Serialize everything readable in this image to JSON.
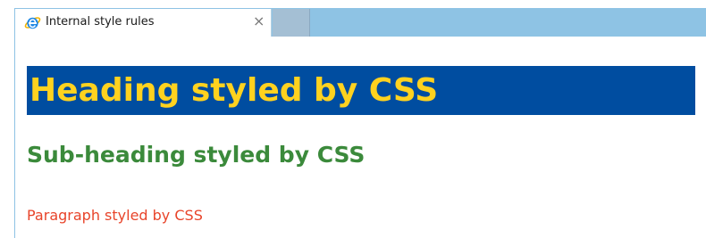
{
  "browser": {
    "tab": {
      "title": "Internal style rules",
      "icon": "internet-explorer-icon",
      "close_glyph": "×"
    },
    "colors": {
      "tabstrip": "#8ec3e4",
      "new_tab": "#a4bfd4"
    }
  },
  "page": {
    "heading": "Heading styled by CSS",
    "subheading": "Sub-heading styled by CSS",
    "paragraph": "Paragraph styled by CSS",
    "colors": {
      "heading_bg": "#004da0",
      "heading_text": "#ffd21f",
      "subheading_text": "#3b8a3b",
      "paragraph_text": "#e8442a"
    }
  }
}
